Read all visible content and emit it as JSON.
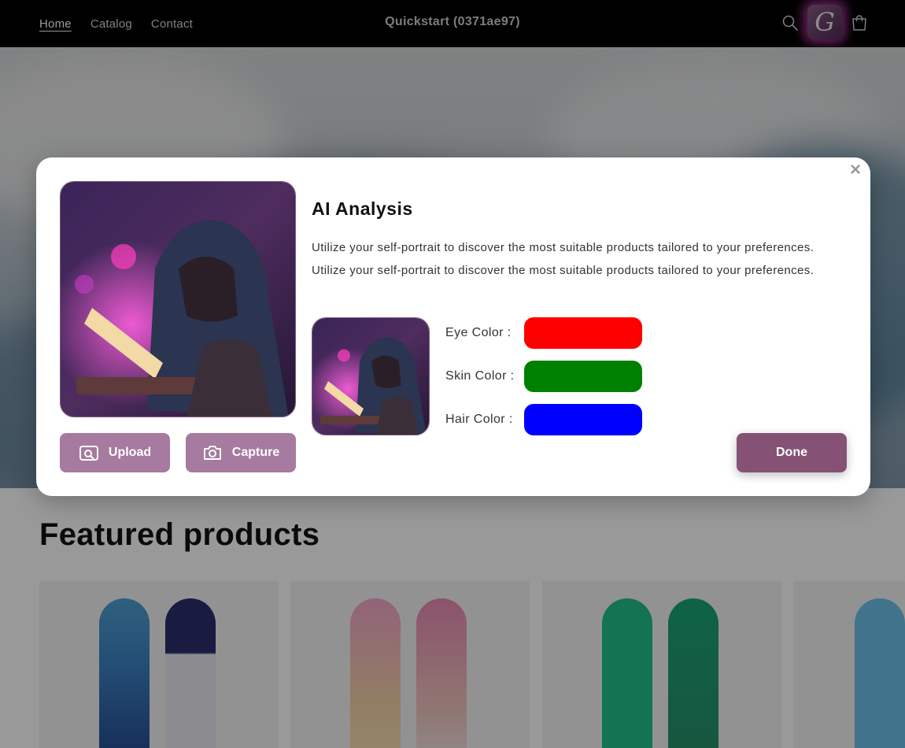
{
  "header": {
    "nav": [
      "Home",
      "Catalog",
      "Contact"
    ],
    "store_title": "Quickstart (0371ae97)",
    "ai_button_letter": "G",
    "icons": [
      "search-icon",
      "cart-icon"
    ]
  },
  "main": {
    "featured_title": "Featured products"
  },
  "modal": {
    "close": "×",
    "title": "AI Analysis",
    "description": "Utilize your self-portrait to discover the most suitable products tailored to your preferences. Utilize your self-portrait to discover the most suitable products tailored to your preferences.",
    "upload_label": "Upload",
    "capture_label": "Capture",
    "done_label": "Done",
    "attributes": [
      {
        "label": "Eye Color :",
        "color": "#ff0000"
      },
      {
        "label": "Skin Color :",
        "color": "#008000"
      },
      {
        "label": "Hair Color :",
        "color": "#0000ff"
      }
    ]
  },
  "colors": {
    "button_light": "#a77a9f",
    "button_dark": "#855275",
    "header_bg": "#000000"
  }
}
